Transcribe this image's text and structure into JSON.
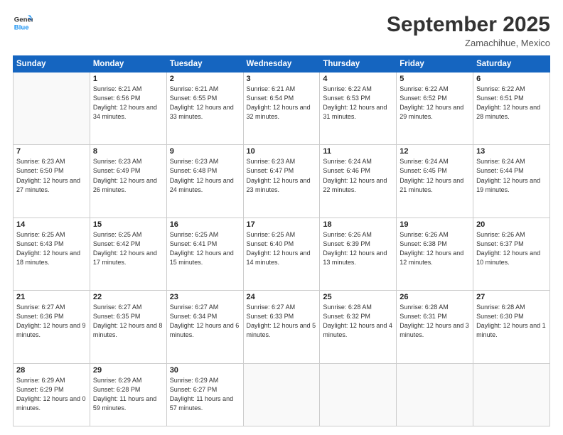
{
  "header": {
    "logo_line1": "General",
    "logo_line2": "Blue",
    "month": "September 2025",
    "location": "Zamachihue, Mexico"
  },
  "days_of_week": [
    "Sunday",
    "Monday",
    "Tuesday",
    "Wednesday",
    "Thursday",
    "Friday",
    "Saturday"
  ],
  "weeks": [
    [
      {
        "day": "",
        "info": ""
      },
      {
        "day": "1",
        "info": "Sunrise: 6:21 AM\nSunset: 6:56 PM\nDaylight: 12 hours\nand 34 minutes."
      },
      {
        "day": "2",
        "info": "Sunrise: 6:21 AM\nSunset: 6:55 PM\nDaylight: 12 hours\nand 33 minutes."
      },
      {
        "day": "3",
        "info": "Sunrise: 6:21 AM\nSunset: 6:54 PM\nDaylight: 12 hours\nand 32 minutes."
      },
      {
        "day": "4",
        "info": "Sunrise: 6:22 AM\nSunset: 6:53 PM\nDaylight: 12 hours\nand 31 minutes."
      },
      {
        "day": "5",
        "info": "Sunrise: 6:22 AM\nSunset: 6:52 PM\nDaylight: 12 hours\nand 29 minutes."
      },
      {
        "day": "6",
        "info": "Sunrise: 6:22 AM\nSunset: 6:51 PM\nDaylight: 12 hours\nand 28 minutes."
      }
    ],
    [
      {
        "day": "7",
        "info": "Sunrise: 6:23 AM\nSunset: 6:50 PM\nDaylight: 12 hours\nand 27 minutes."
      },
      {
        "day": "8",
        "info": "Sunrise: 6:23 AM\nSunset: 6:49 PM\nDaylight: 12 hours\nand 26 minutes."
      },
      {
        "day": "9",
        "info": "Sunrise: 6:23 AM\nSunset: 6:48 PM\nDaylight: 12 hours\nand 24 minutes."
      },
      {
        "day": "10",
        "info": "Sunrise: 6:23 AM\nSunset: 6:47 PM\nDaylight: 12 hours\nand 23 minutes."
      },
      {
        "day": "11",
        "info": "Sunrise: 6:24 AM\nSunset: 6:46 PM\nDaylight: 12 hours\nand 22 minutes."
      },
      {
        "day": "12",
        "info": "Sunrise: 6:24 AM\nSunset: 6:45 PM\nDaylight: 12 hours\nand 21 minutes."
      },
      {
        "day": "13",
        "info": "Sunrise: 6:24 AM\nSunset: 6:44 PM\nDaylight: 12 hours\nand 19 minutes."
      }
    ],
    [
      {
        "day": "14",
        "info": "Sunrise: 6:25 AM\nSunset: 6:43 PM\nDaylight: 12 hours\nand 18 minutes."
      },
      {
        "day": "15",
        "info": "Sunrise: 6:25 AM\nSunset: 6:42 PM\nDaylight: 12 hours\nand 17 minutes."
      },
      {
        "day": "16",
        "info": "Sunrise: 6:25 AM\nSunset: 6:41 PM\nDaylight: 12 hours\nand 15 minutes."
      },
      {
        "day": "17",
        "info": "Sunrise: 6:25 AM\nSunset: 6:40 PM\nDaylight: 12 hours\nand 14 minutes."
      },
      {
        "day": "18",
        "info": "Sunrise: 6:26 AM\nSunset: 6:39 PM\nDaylight: 12 hours\nand 13 minutes."
      },
      {
        "day": "19",
        "info": "Sunrise: 6:26 AM\nSunset: 6:38 PM\nDaylight: 12 hours\nand 12 minutes."
      },
      {
        "day": "20",
        "info": "Sunrise: 6:26 AM\nSunset: 6:37 PM\nDaylight: 12 hours\nand 10 minutes."
      }
    ],
    [
      {
        "day": "21",
        "info": "Sunrise: 6:27 AM\nSunset: 6:36 PM\nDaylight: 12 hours\nand 9 minutes."
      },
      {
        "day": "22",
        "info": "Sunrise: 6:27 AM\nSunset: 6:35 PM\nDaylight: 12 hours\nand 8 minutes."
      },
      {
        "day": "23",
        "info": "Sunrise: 6:27 AM\nSunset: 6:34 PM\nDaylight: 12 hours\nand 6 minutes."
      },
      {
        "day": "24",
        "info": "Sunrise: 6:27 AM\nSunset: 6:33 PM\nDaylight: 12 hours\nand 5 minutes."
      },
      {
        "day": "25",
        "info": "Sunrise: 6:28 AM\nSunset: 6:32 PM\nDaylight: 12 hours\nand 4 minutes."
      },
      {
        "day": "26",
        "info": "Sunrise: 6:28 AM\nSunset: 6:31 PM\nDaylight: 12 hours\nand 3 minutes."
      },
      {
        "day": "27",
        "info": "Sunrise: 6:28 AM\nSunset: 6:30 PM\nDaylight: 12 hours\nand 1 minute."
      }
    ],
    [
      {
        "day": "28",
        "info": "Sunrise: 6:29 AM\nSunset: 6:29 PM\nDaylight: 12 hours\nand 0 minutes."
      },
      {
        "day": "29",
        "info": "Sunrise: 6:29 AM\nSunset: 6:28 PM\nDaylight: 11 hours\nand 59 minutes."
      },
      {
        "day": "30",
        "info": "Sunrise: 6:29 AM\nSunset: 6:27 PM\nDaylight: 11 hours\nand 57 minutes."
      },
      {
        "day": "",
        "info": ""
      },
      {
        "day": "",
        "info": ""
      },
      {
        "day": "",
        "info": ""
      },
      {
        "day": "",
        "info": ""
      }
    ]
  ]
}
